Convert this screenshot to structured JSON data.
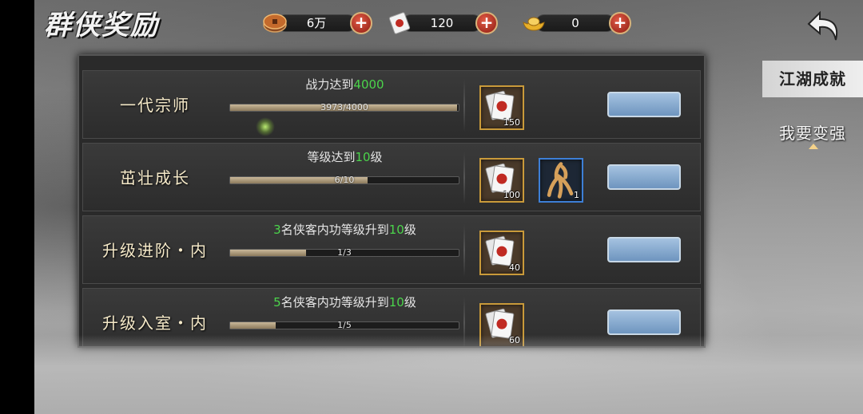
{
  "title": "群侠奖励",
  "resources": [
    {
      "icon": "coin-icon",
      "value": "6万"
    },
    {
      "icon": "voucher-icon",
      "value": "120"
    },
    {
      "icon": "gold-ingot-icon",
      "value": "0"
    }
  ],
  "tabs": [
    {
      "label": "江湖成就"
    },
    {
      "label": "我要变强"
    }
  ],
  "rows": [
    {
      "name": "一代宗师",
      "cond_prefix": "战力达到",
      "cond_hl1": "4000",
      "cond_mid": "",
      "cond_hl2": "",
      "cond_suffix": "",
      "progress_text": "3973/4000",
      "progress": 0.993,
      "rewards": [
        {
          "icon": "voucher-icon",
          "count": "150",
          "frame": "gold"
        }
      ]
    },
    {
      "name": "茁壮成长",
      "cond_prefix": "等级达到",
      "cond_hl1": "10",
      "cond_mid": "级",
      "cond_hl2": "",
      "cond_suffix": "",
      "progress_text": "6/10",
      "progress": 0.6,
      "rewards": [
        {
          "icon": "voucher-icon",
          "count": "100",
          "frame": "gold"
        },
        {
          "icon": "ginseng-icon",
          "count": "1",
          "frame": "blue"
        }
      ]
    },
    {
      "name": "升级进阶・内",
      "cond_prefix": "",
      "cond_hl1": "3",
      "cond_mid": "名侠客内功等级升到",
      "cond_hl2": "10",
      "cond_suffix": "级",
      "progress_text": "1/3",
      "progress": 0.333,
      "rewards": [
        {
          "icon": "voucher-icon",
          "count": "40",
          "frame": "gold"
        }
      ]
    },
    {
      "name": "升级入室・内",
      "cond_prefix": "",
      "cond_hl1": "5",
      "cond_mid": "名侠客内功等级升到",
      "cond_hl2": "10",
      "cond_suffix": "级",
      "progress_text": "1/5",
      "progress": 0.2,
      "rewards": [
        {
          "icon": "voucher-icon",
          "count": "60",
          "frame": "gold"
        }
      ]
    }
  ],
  "colors": {
    "highlight": "#4bd44b",
    "claim_button": "#8fb0d6"
  }
}
